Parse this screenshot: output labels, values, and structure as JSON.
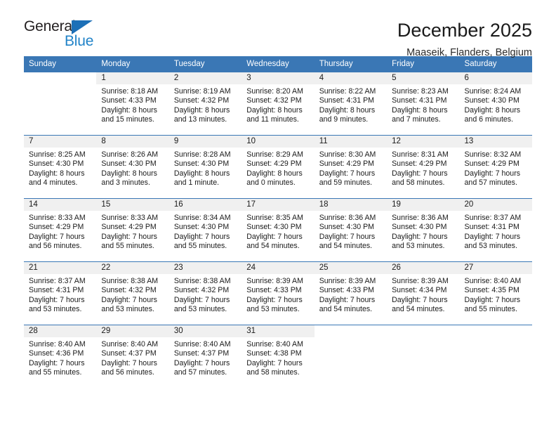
{
  "brand": {
    "name_part1": "General",
    "name_part2": "Blue",
    "triangle_color": "#1d70b7",
    "blue_color": "#2183c8"
  },
  "header": {
    "title": "December 2025",
    "subtitle": "Maaseik, Flanders, Belgium"
  },
  "theme": {
    "header_row_bg": "#3a77b5",
    "header_row_text": "#ffffff",
    "daynum_band_bg": "#f0f0f0",
    "row_divider": "#3a77b5"
  },
  "weekday_headers": [
    "Sunday",
    "Monday",
    "Tuesday",
    "Wednesday",
    "Thursday",
    "Friday",
    "Saturday"
  ],
  "weeks": [
    [
      {
        "day": "",
        "sunrise": "",
        "sunset": "",
        "daylight": "",
        "empty": true
      },
      {
        "day": "1",
        "sunrise": "Sunrise: 8:18 AM",
        "sunset": "Sunset: 4:33 PM",
        "daylight": "Daylight: 8 hours and 15 minutes."
      },
      {
        "day": "2",
        "sunrise": "Sunrise: 8:19 AM",
        "sunset": "Sunset: 4:32 PM",
        "daylight": "Daylight: 8 hours and 13 minutes."
      },
      {
        "day": "3",
        "sunrise": "Sunrise: 8:20 AM",
        "sunset": "Sunset: 4:32 PM",
        "daylight": "Daylight: 8 hours and 11 minutes."
      },
      {
        "day": "4",
        "sunrise": "Sunrise: 8:22 AM",
        "sunset": "Sunset: 4:31 PM",
        "daylight": "Daylight: 8 hours and 9 minutes."
      },
      {
        "day": "5",
        "sunrise": "Sunrise: 8:23 AM",
        "sunset": "Sunset: 4:31 PM",
        "daylight": "Daylight: 8 hours and 7 minutes."
      },
      {
        "day": "6",
        "sunrise": "Sunrise: 8:24 AM",
        "sunset": "Sunset: 4:30 PM",
        "daylight": "Daylight: 8 hours and 6 minutes."
      }
    ],
    [
      {
        "day": "7",
        "sunrise": "Sunrise: 8:25 AM",
        "sunset": "Sunset: 4:30 PM",
        "daylight": "Daylight: 8 hours and 4 minutes."
      },
      {
        "day": "8",
        "sunrise": "Sunrise: 8:26 AM",
        "sunset": "Sunset: 4:30 PM",
        "daylight": "Daylight: 8 hours and 3 minutes."
      },
      {
        "day": "9",
        "sunrise": "Sunrise: 8:28 AM",
        "sunset": "Sunset: 4:30 PM",
        "daylight": "Daylight: 8 hours and 1 minute."
      },
      {
        "day": "10",
        "sunrise": "Sunrise: 8:29 AM",
        "sunset": "Sunset: 4:29 PM",
        "daylight": "Daylight: 8 hours and 0 minutes."
      },
      {
        "day": "11",
        "sunrise": "Sunrise: 8:30 AM",
        "sunset": "Sunset: 4:29 PM",
        "daylight": "Daylight: 7 hours and 59 minutes."
      },
      {
        "day": "12",
        "sunrise": "Sunrise: 8:31 AM",
        "sunset": "Sunset: 4:29 PM",
        "daylight": "Daylight: 7 hours and 58 minutes."
      },
      {
        "day": "13",
        "sunrise": "Sunrise: 8:32 AM",
        "sunset": "Sunset: 4:29 PM",
        "daylight": "Daylight: 7 hours and 57 minutes."
      }
    ],
    [
      {
        "day": "14",
        "sunrise": "Sunrise: 8:33 AM",
        "sunset": "Sunset: 4:29 PM",
        "daylight": "Daylight: 7 hours and 56 minutes."
      },
      {
        "day": "15",
        "sunrise": "Sunrise: 8:33 AM",
        "sunset": "Sunset: 4:29 PM",
        "daylight": "Daylight: 7 hours and 55 minutes."
      },
      {
        "day": "16",
        "sunrise": "Sunrise: 8:34 AM",
        "sunset": "Sunset: 4:30 PM",
        "daylight": "Daylight: 7 hours and 55 minutes."
      },
      {
        "day": "17",
        "sunrise": "Sunrise: 8:35 AM",
        "sunset": "Sunset: 4:30 PM",
        "daylight": "Daylight: 7 hours and 54 minutes."
      },
      {
        "day": "18",
        "sunrise": "Sunrise: 8:36 AM",
        "sunset": "Sunset: 4:30 PM",
        "daylight": "Daylight: 7 hours and 54 minutes."
      },
      {
        "day": "19",
        "sunrise": "Sunrise: 8:36 AM",
        "sunset": "Sunset: 4:30 PM",
        "daylight": "Daylight: 7 hours and 53 minutes."
      },
      {
        "day": "20",
        "sunrise": "Sunrise: 8:37 AM",
        "sunset": "Sunset: 4:31 PM",
        "daylight": "Daylight: 7 hours and 53 minutes."
      }
    ],
    [
      {
        "day": "21",
        "sunrise": "Sunrise: 8:37 AM",
        "sunset": "Sunset: 4:31 PM",
        "daylight": "Daylight: 7 hours and 53 minutes."
      },
      {
        "day": "22",
        "sunrise": "Sunrise: 8:38 AM",
        "sunset": "Sunset: 4:32 PM",
        "daylight": "Daylight: 7 hours and 53 minutes."
      },
      {
        "day": "23",
        "sunrise": "Sunrise: 8:38 AM",
        "sunset": "Sunset: 4:32 PM",
        "daylight": "Daylight: 7 hours and 53 minutes."
      },
      {
        "day": "24",
        "sunrise": "Sunrise: 8:39 AM",
        "sunset": "Sunset: 4:33 PM",
        "daylight": "Daylight: 7 hours and 53 minutes."
      },
      {
        "day": "25",
        "sunrise": "Sunrise: 8:39 AM",
        "sunset": "Sunset: 4:33 PM",
        "daylight": "Daylight: 7 hours and 54 minutes."
      },
      {
        "day": "26",
        "sunrise": "Sunrise: 8:39 AM",
        "sunset": "Sunset: 4:34 PM",
        "daylight": "Daylight: 7 hours and 54 minutes."
      },
      {
        "day": "27",
        "sunrise": "Sunrise: 8:40 AM",
        "sunset": "Sunset: 4:35 PM",
        "daylight": "Daylight: 7 hours and 55 minutes."
      }
    ],
    [
      {
        "day": "28",
        "sunrise": "Sunrise: 8:40 AM",
        "sunset": "Sunset: 4:36 PM",
        "daylight": "Daylight: 7 hours and 55 minutes."
      },
      {
        "day": "29",
        "sunrise": "Sunrise: 8:40 AM",
        "sunset": "Sunset: 4:37 PM",
        "daylight": "Daylight: 7 hours and 56 minutes."
      },
      {
        "day": "30",
        "sunrise": "Sunrise: 8:40 AM",
        "sunset": "Sunset: 4:37 PM",
        "daylight": "Daylight: 7 hours and 57 minutes."
      },
      {
        "day": "31",
        "sunrise": "Sunrise: 8:40 AM",
        "sunset": "Sunset: 4:38 PM",
        "daylight": "Daylight: 7 hours and 58 minutes."
      },
      {
        "day": "",
        "sunrise": "",
        "sunset": "",
        "daylight": "",
        "empty": true
      },
      {
        "day": "",
        "sunrise": "",
        "sunset": "",
        "daylight": "",
        "empty": true
      },
      {
        "day": "",
        "sunrise": "",
        "sunset": "",
        "daylight": "",
        "empty": true
      }
    ]
  ]
}
